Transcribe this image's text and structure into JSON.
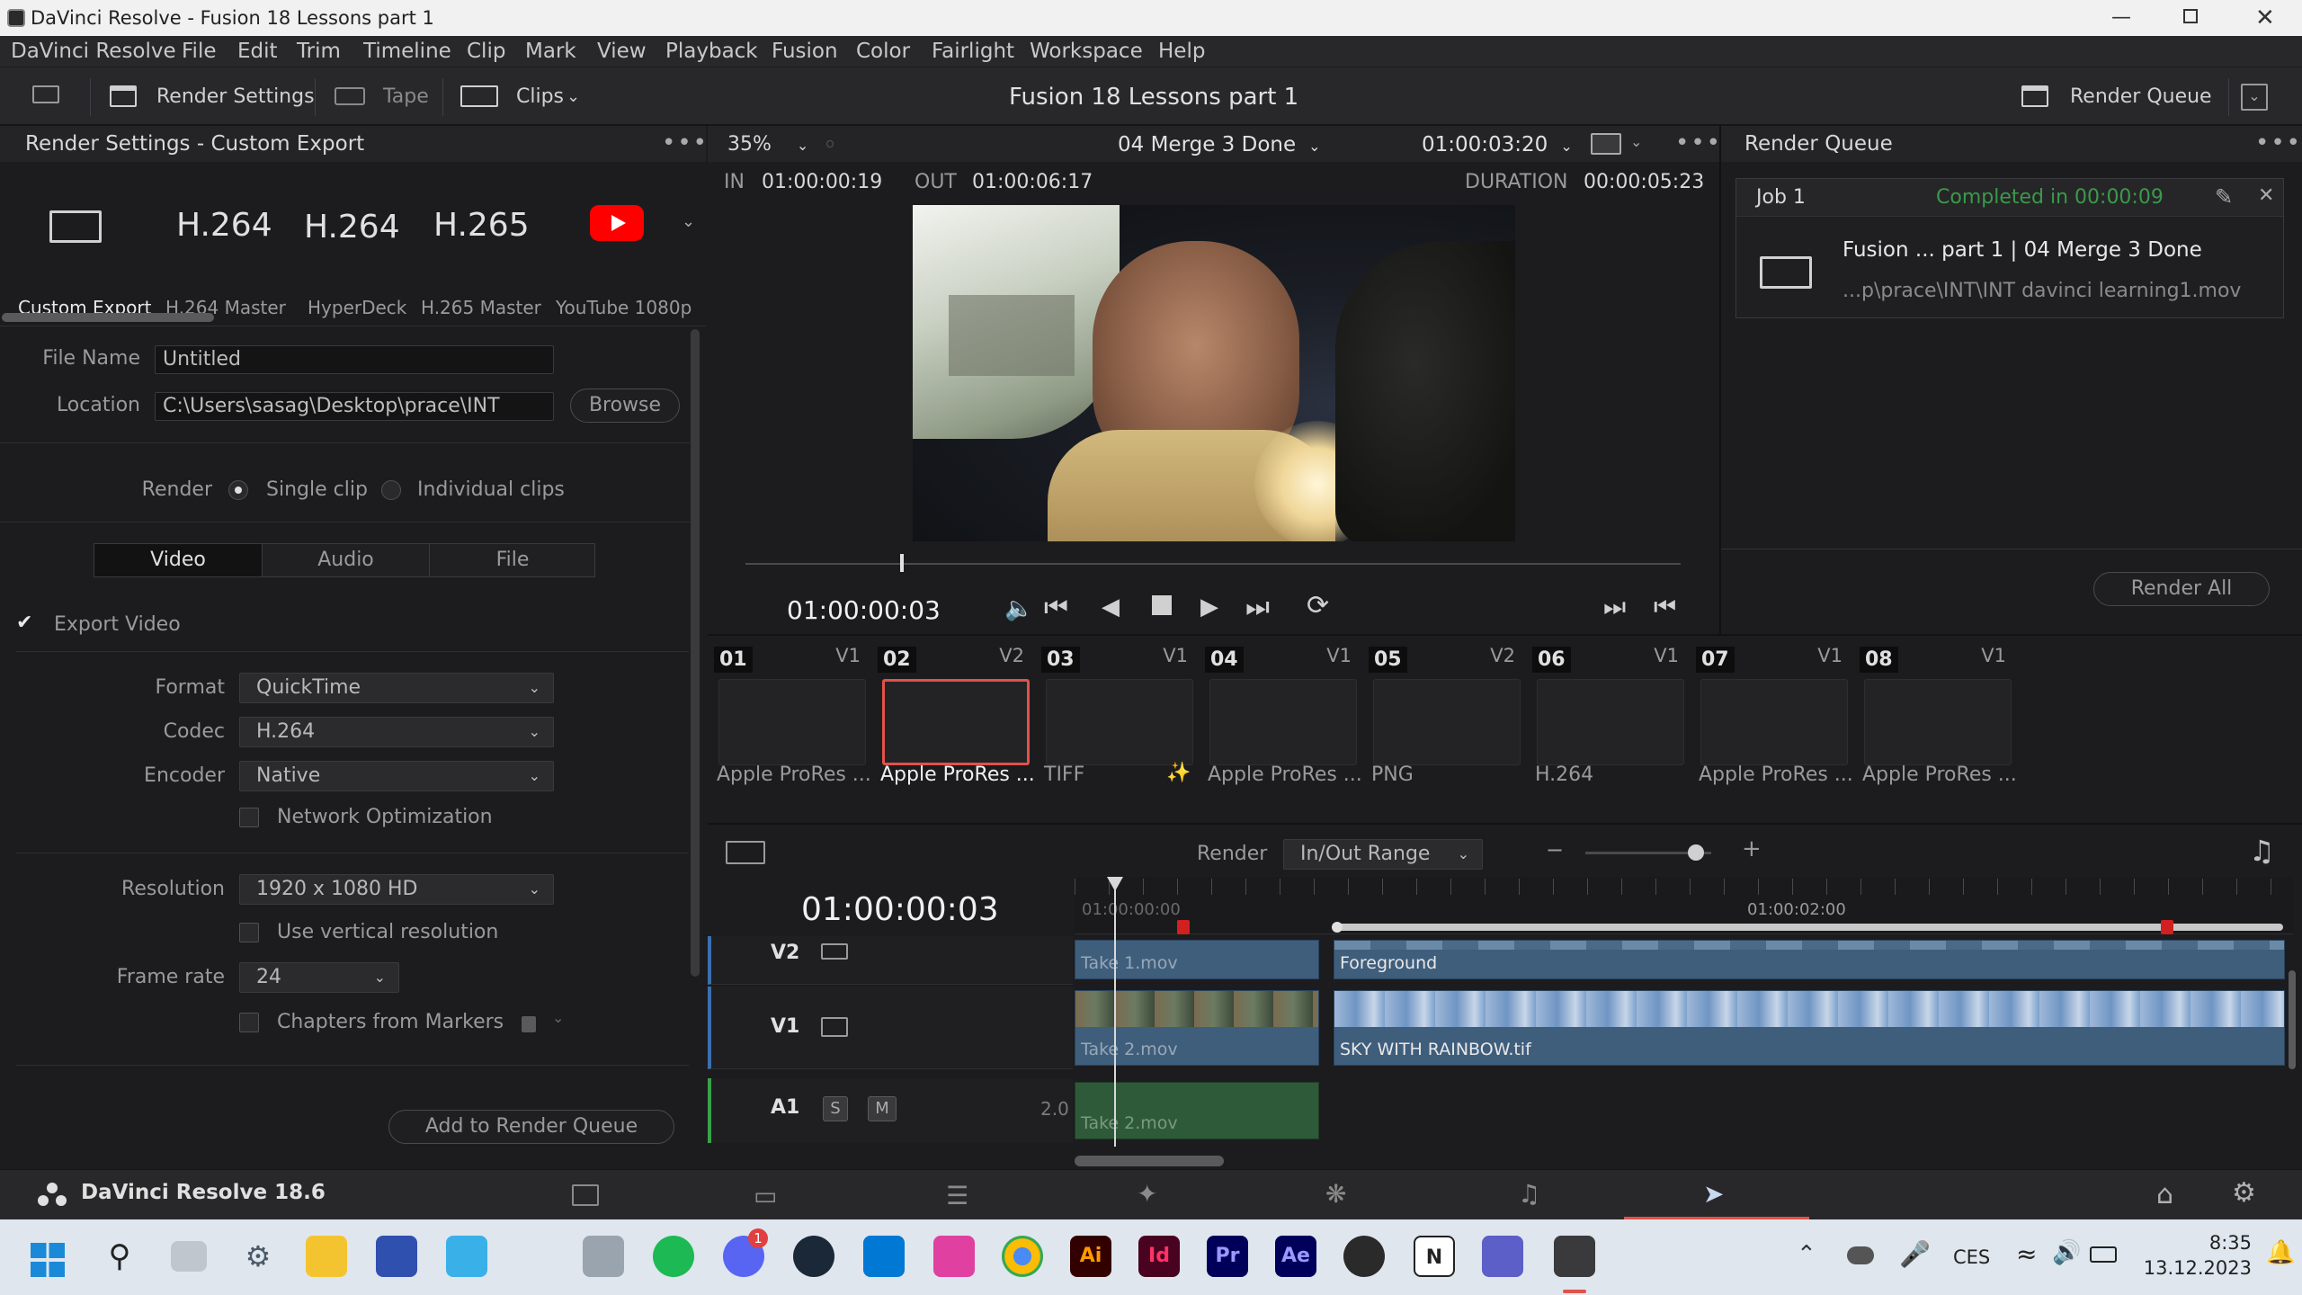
{
  "window": {
    "title": "DaVinci Resolve - Fusion 18  Lessons part 1"
  },
  "menu": [
    "DaVinci Resolve",
    "File",
    "Edit",
    "Trim",
    "Timeline",
    "Clip",
    "Mark",
    "View",
    "Playback",
    "Fusion",
    "Color",
    "Fairlight",
    "Workspace",
    "Help"
  ],
  "toolbar": {
    "render_settings": "Render Settings",
    "tape": "Tape",
    "clips": "Clips",
    "project_title": "Fusion 18  Lessons part 1",
    "render_queue": "Render Queue"
  },
  "render_settings": {
    "header": "Render Settings - Custom Export",
    "presets": [
      {
        "title": "",
        "label": "Custom Export"
      },
      {
        "title": "H.264",
        "label": "H.264 Master"
      },
      {
        "title": "H.264",
        "label": "HyperDeck"
      },
      {
        "title": "H.265",
        "label": "H.265 Master"
      },
      {
        "title": "",
        "label": "YouTube 1080p"
      }
    ],
    "file_name_label": "File Name",
    "file_name_value": "Untitled",
    "location_label": "Location",
    "location_value": "C:\\Users\\sasag\\Desktop\\prace\\INT",
    "browse": "Browse",
    "render_label": "Render",
    "single_clip": "Single clip",
    "individual_clips": "Individual clips",
    "tabs": [
      "Video",
      "Audio",
      "File"
    ],
    "export_video": "Export Video",
    "format_label": "Format",
    "format_value": "QuickTime",
    "codec_label": "Codec",
    "codec_value": "H.264",
    "encoder_label": "Encoder",
    "encoder_value": "Native",
    "network_opt": "Network Optimization",
    "resolution_label": "Resolution",
    "resolution_value": "1920 x 1080 HD",
    "vertical_res": "Use vertical resolution",
    "framerate_label": "Frame rate",
    "framerate_value": "24",
    "chapters": "Chapters from Markers",
    "add_queue": "Add to Render Queue"
  },
  "viewer": {
    "zoom": "35%",
    "clip_name": "04 Merge 3 Done",
    "timecode_top": "01:00:03:20",
    "in_label": "IN",
    "in_value": "01:00:00:19",
    "out_label": "OUT",
    "out_value": "01:00:06:17",
    "duration_label": "DURATION",
    "duration_value": "00:00:05:23",
    "current_tc": "01:00:00:03"
  },
  "render_queue": {
    "header": "Render Queue",
    "job_label": "Job 1",
    "job_status": "Completed in 00:00:09",
    "job_title": "Fusion ... part 1 | 04 Merge 3 Done",
    "job_path": "...p\\prace\\INT\\INT davinci learning1.mov",
    "render_all": "Render All"
  },
  "clips": [
    {
      "num": "01",
      "track": "V1",
      "codec": "Apple ProRes ..."
    },
    {
      "num": "02",
      "track": "V2",
      "codec": "Apple ProRes ..."
    },
    {
      "num": "03",
      "track": "V1",
      "codec": "TIFF"
    },
    {
      "num": "04",
      "track": "V1",
      "codec": "Apple ProRes ..."
    },
    {
      "num": "05",
      "track": "V2",
      "codec": "PNG"
    },
    {
      "num": "06",
      "track": "V1",
      "codec": "H.264"
    },
    {
      "num": "07",
      "track": "V1",
      "codec": "Apple ProRes ..."
    },
    {
      "num": "08",
      "track": "V1",
      "codec": "Apple ProRes ..."
    }
  ],
  "timeline": {
    "render_label": "Render",
    "render_mode": "In/Out Range",
    "timecode": "01:00:00:03",
    "ruler_start": "01:00:00:00",
    "ruler_mid": "01:00:02:00",
    "tracks": [
      {
        "name": "V2",
        "clip_a": "Take 1.mov",
        "clip_b": "Foreground"
      },
      {
        "name": "V1",
        "clip_a": "Take 2.mov",
        "clip_b": "SKY WITH RAINBOW.tif"
      },
      {
        "name": "A1",
        "clip_a": "Take 2.mov",
        "level": "2.0",
        "solo": "S",
        "mute": "M"
      }
    ]
  },
  "pages": {
    "app_name": "DaVinci Resolve 18.6"
  },
  "taskbar": {
    "apps": [
      "Ai",
      "Id",
      "Pr",
      "Ae"
    ],
    "discord_badge": "1",
    "lang": "CES",
    "time": "8:35",
    "date": "13.12.2023"
  }
}
